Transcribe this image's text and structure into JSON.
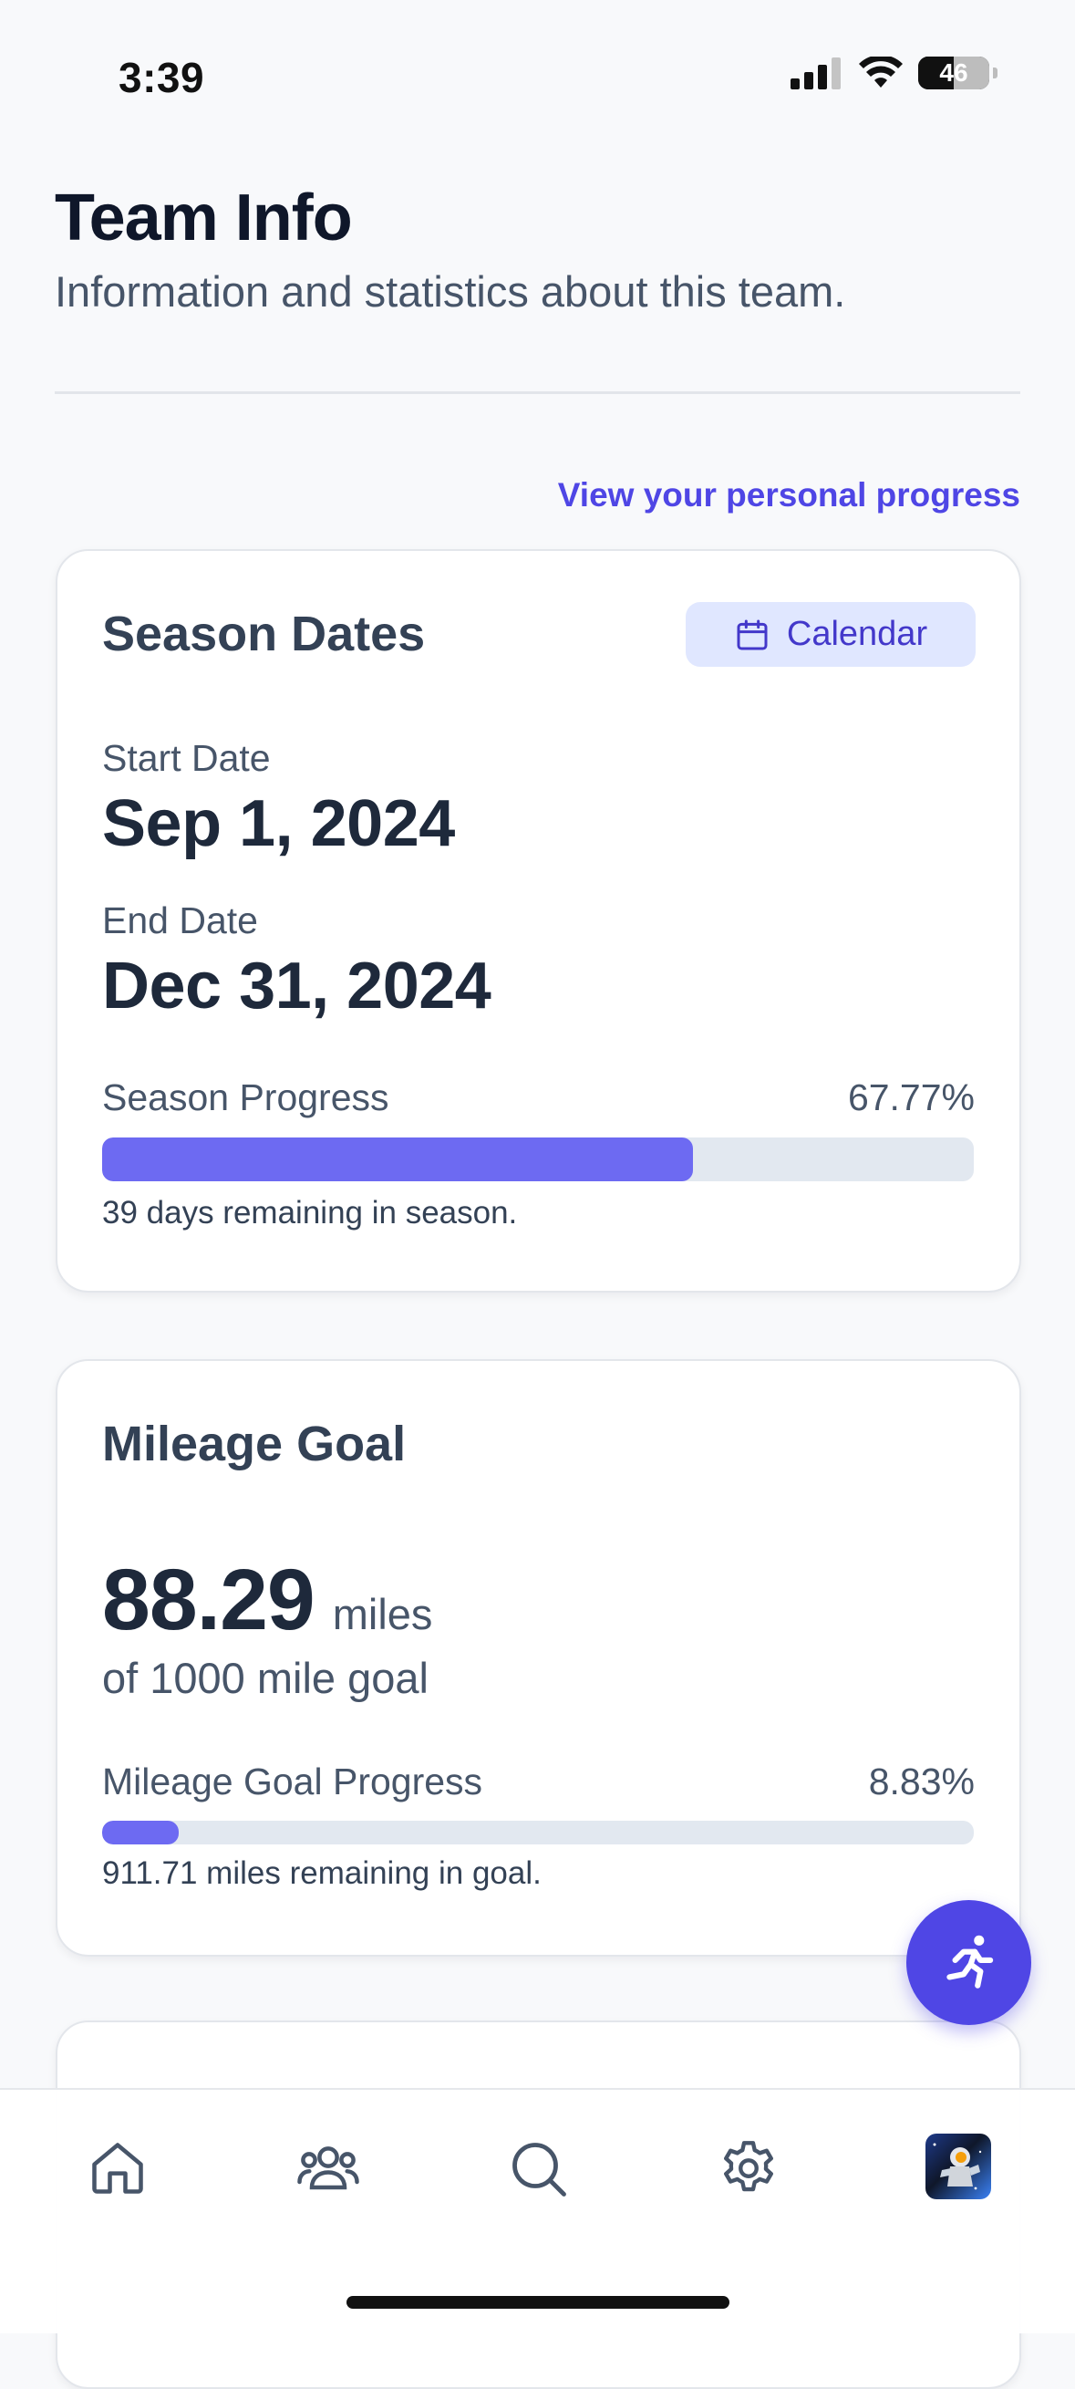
{
  "status_bar": {
    "time": "3:39",
    "battery": "46"
  },
  "header": {
    "title": "Team Info",
    "subtitle": "Information and statistics about this team."
  },
  "personal_link": "View your personal progress",
  "season": {
    "title": "Season Dates",
    "calendar_button": "Calendar",
    "start_label": "Start Date",
    "start_date": "Sep 1, 2024",
    "end_label": "End Date",
    "end_date": "Dec 31, 2024",
    "progress_label": "Season Progress",
    "progress_text": "67.77%",
    "progress_value": 0.6777,
    "remaining": "39 days remaining in season."
  },
  "mileage": {
    "title": "Mileage Goal",
    "miles": "88.29",
    "unit": "miles",
    "goal": "of 1000 mile goal",
    "progress_label": "Mileage Goal Progress",
    "progress_text": "8.83%",
    "progress_value": 0.0883,
    "remaining": "911.71 miles remaining in goal."
  },
  "bottom_nav": {
    "items": [
      "home-icon",
      "team-icon",
      "search-icon",
      "settings-icon",
      "avatar"
    ]
  },
  "colors": {
    "accent": "#4f46e5",
    "progress_fill": "#6d6af2",
    "track": "#e2e8f0"
  }
}
